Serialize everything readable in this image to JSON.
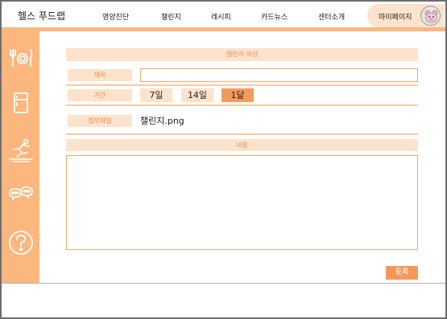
{
  "header": {
    "logo": "헬스 푸드랩",
    "nav": [
      "영양진단",
      "챌린지",
      "레시피",
      "카드뉴스",
      "센터소개"
    ],
    "mypage_label": "마이페이지"
  },
  "sidebar": {
    "icons": [
      "utensils-icon",
      "refrigerator-icon",
      "exercise-icon",
      "chat-icon",
      "help-icon"
    ]
  },
  "form": {
    "title": "챌린지 작성",
    "title_label": "제목",
    "title_value": "",
    "period_label": "기간",
    "periods": [
      "7일",
      "14일",
      "1달"
    ],
    "selected_period": "1달",
    "attachment_label": "첨부파일",
    "attachment_name": "챌린지.png",
    "content_label": "내용",
    "content_value": "",
    "submit_label": "등록"
  },
  "colors": {
    "accent": "#fbb77e",
    "label_bg": "#fde3cc",
    "label_text": "#f08c4a",
    "active": "#f5995a"
  }
}
